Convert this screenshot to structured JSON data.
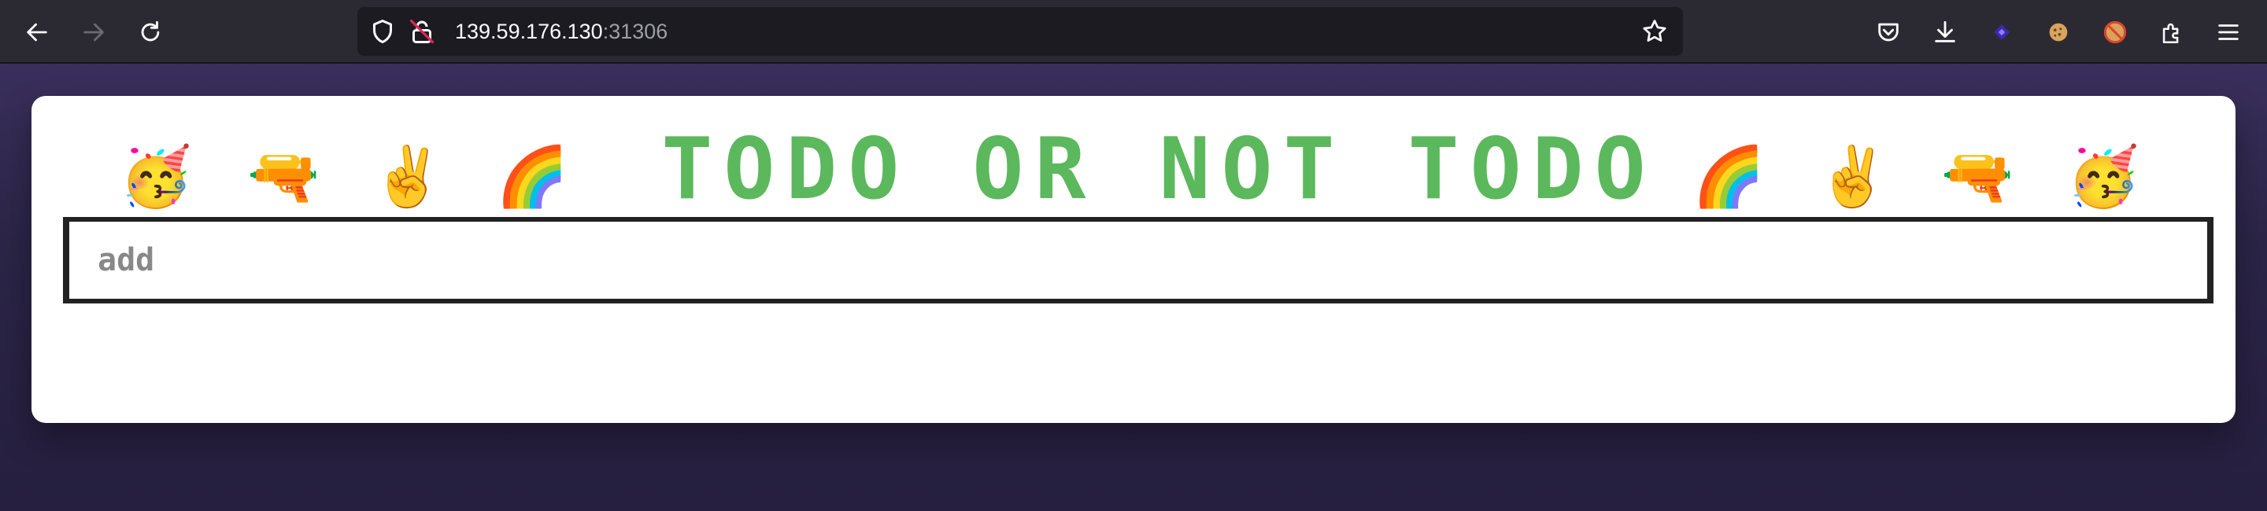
{
  "browser": {
    "url_host": "139.59.176.130",
    "url_port": ":31306",
    "icons": [
      "back-icon",
      "forward-icon",
      "reload-icon",
      "shield-icon",
      "insecure-lock-icon",
      "bookmark-star-icon",
      "pocket-icon",
      "download-icon",
      "extension-purple-icon",
      "cookie-icon",
      "blocked-cookie-icon",
      "extensions-icon",
      "menu-icon"
    ]
  },
  "app": {
    "title": "TODO OR NOT TODO",
    "emojis_left": [
      "🥳",
      "🔫",
      "✌️",
      "🌈"
    ],
    "emojis_right": [
      "🌈",
      "✌️",
      "🔫",
      "🥳"
    ],
    "add_input": {
      "placeholder": "add",
      "value": ""
    }
  },
  "colors": {
    "title_green": "#5cb85c",
    "page_bg": "#2b2547",
    "toolbar_bg": "#2b2a33"
  }
}
